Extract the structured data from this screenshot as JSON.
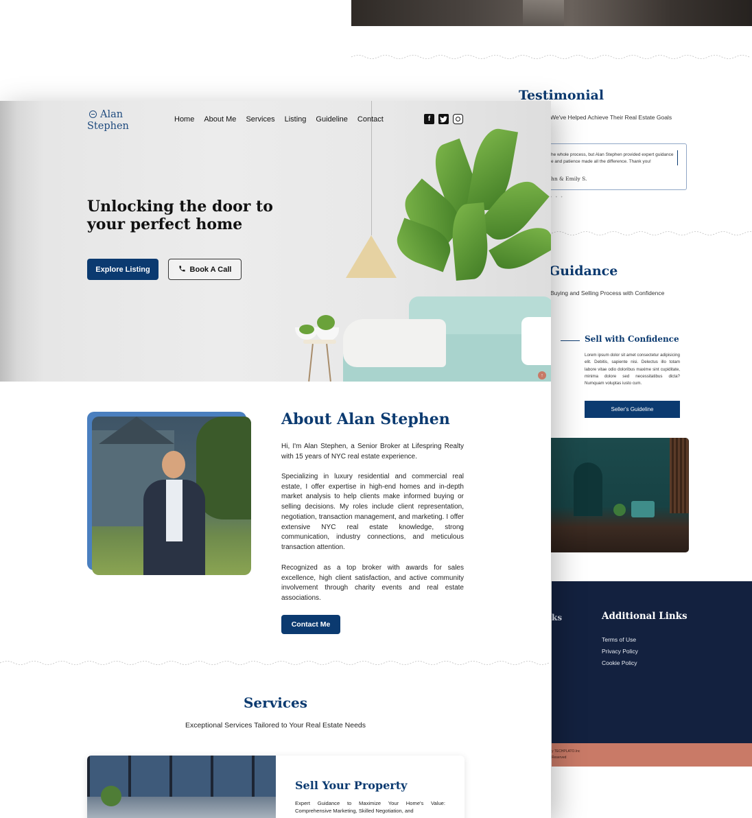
{
  "back": {
    "testimonial": {
      "title": "Testimonial",
      "subtitle": "We've Helped Achieve Their Real Estate Goals",
      "quote": "he whole process, but Alan Stephen provided expert guidance e and patience made all the difference. Thank you!",
      "author": "hn & Emily S.",
      "dots": "• • •"
    },
    "guidance": {
      "title": "Guidance",
      "subtitle": "Buying and Selling Process with Confidence",
      "sell_title": "Sell with Confidence",
      "sell_text": "Lorem ipsum dolor sit amet consectetur adipisicing elit. Debitis, sapiente nisi. Delectus illo totam labore vitae odio doloribus maxime sint cupiditate, minima dolore sed necessitatibus dicta? Numquam voluptas iusto cum.",
      "sell_button": "Seller's Guideline"
    },
    "footer": {
      "partial_heading": "ks",
      "heading": "Additional Links",
      "links": [
        "Terms of Use",
        "Privacy Policy",
        "Cookie Policy"
      ],
      "bottom_line1": "y TECHPLATO.Inc",
      "bottom_line2": "Reserved"
    }
  },
  "header": {
    "logo_line1": "Alan",
    "logo_line2": "Stephen",
    "nav": [
      "Home",
      "About Me",
      "Services",
      "Listing",
      "Guideline",
      "Contact"
    ],
    "socials": [
      {
        "icon": "facebook-icon",
        "glyph": "f"
      },
      {
        "icon": "twitter-icon",
        "glyph": "t"
      },
      {
        "icon": "instagram-icon",
        "glyph": ""
      }
    ]
  },
  "hero": {
    "title": "Unlocking the door to your perfect home",
    "explore_button": "Explore Listing",
    "call_button": "Book A Call",
    "scroll_top": "↑"
  },
  "about": {
    "title": "About Alan Stephen",
    "p1": "Hi, I'm Alan Stephen, a Senior Broker at Lifespring Realty with 15 years of NYC real estate experience.",
    "p2": "Specializing in luxury residential and commercial real estate, I offer expertise in high-end homes and in-depth market analysis to help clients make informed buying or selling decisions. My roles include client representation, negotiation, transaction management, and marketing. I offer extensive NYC real estate knowledge, strong communication, industry connections, and meticulous transaction attention.",
    "p3": "Recognized as a top broker with awards for sales excellence, high client satisfaction, and active community involvement through charity events and real estate associations.",
    "contact_button": "Contact Me"
  },
  "services": {
    "title": "Services",
    "subtitle": "Exceptional Services Tailored to Your Real Estate Needs",
    "card_title": "Sell Your Property",
    "card_text": "Expert Guidance to Maximize Your Home's Value: Comprehensive Marketing, Skilled Negotiation, and"
  },
  "colors": {
    "primary": "#0b3a70",
    "footer_bg": "#13213f",
    "footer_bottom": "#c97a67"
  }
}
